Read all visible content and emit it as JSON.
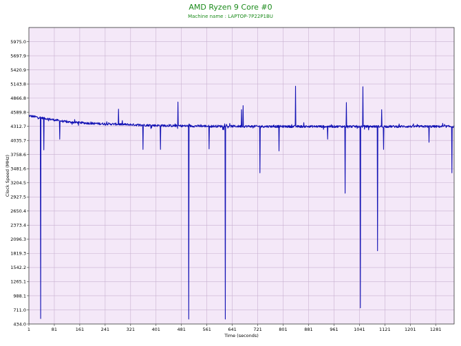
{
  "chart_data": {
    "type": "line",
    "title": "AMD Ryzen 9 Core #0",
    "subtitle": "Machine name : LAPTOP-7P22P1BU",
    "xlabel": "Time (seconds)",
    "ylabel": "Clock Speed (MHz)",
    "xlim": [
      1,
      1339
    ],
    "ylim": [
      434.0,
      6252.0
    ],
    "x_ticks": [
      "1",
      "81",
      "161",
      "241",
      "321",
      "401",
      "481",
      "561",
      "641",
      "721",
      "801",
      "881",
      "961",
      "1041",
      "1121",
      "1201",
      "1281"
    ],
    "y_ticks": [
      "434.0",
      "711.0",
      "988.1",
      "1265.1",
      "1542.2",
      "1819.3",
      "2096.3",
      "2373.4",
      "2650.4",
      "2927.5",
      "3204.5",
      "3481.6",
      "3758.6",
      "4035.7",
      "4312.7",
      "4589.8",
      "4866.8",
      "5143.8",
      "5420.9",
      "5697.9",
      "5975.0"
    ],
    "grid": true,
    "background_color": "#f4e8f8",
    "grid_color": "#c8b0d0",
    "line_color": "#1212b4",
    "baseline": [
      [
        1,
        4520
      ],
      [
        20,
        4500
      ],
      [
        40,
        4480
      ],
      [
        80,
        4440
      ],
      [
        120,
        4400
      ],
      [
        200,
        4370
      ],
      [
        300,
        4350
      ],
      [
        400,
        4330
      ],
      [
        500,
        4320
      ],
      [
        600,
        4315
      ],
      [
        800,
        4310
      ],
      [
        1000,
        4310
      ],
      [
        1200,
        4310
      ],
      [
        1339,
        4310
      ]
    ],
    "spikes_up": [
      [
        283,
        4650
      ],
      [
        415,
        4640
      ],
      [
        470,
        4790
      ],
      [
        670,
        4640
      ],
      [
        675,
        4720
      ],
      [
        840,
        5100
      ],
      [
        1000,
        4780
      ],
      [
        1052,
        5090
      ],
      [
        1111,
        4640
      ]
    ],
    "spikes_down": [
      [
        38,
        540
      ],
      [
        48,
        3850
      ],
      [
        98,
        4060
      ],
      [
        360,
        3860
      ],
      [
        415,
        3860
      ],
      [
        504,
        530
      ],
      [
        568,
        3870
      ],
      [
        619,
        530
      ],
      [
        728,
        3400
      ],
      [
        788,
        3830
      ],
      [
        941,
        4060
      ],
      [
        996,
        3000
      ],
      [
        1044,
        750
      ],
      [
        1098,
        1870
      ],
      [
        1117,
        3860
      ],
      [
        1260,
        4000
      ],
      [
        1332,
        3400
      ]
    ]
  }
}
